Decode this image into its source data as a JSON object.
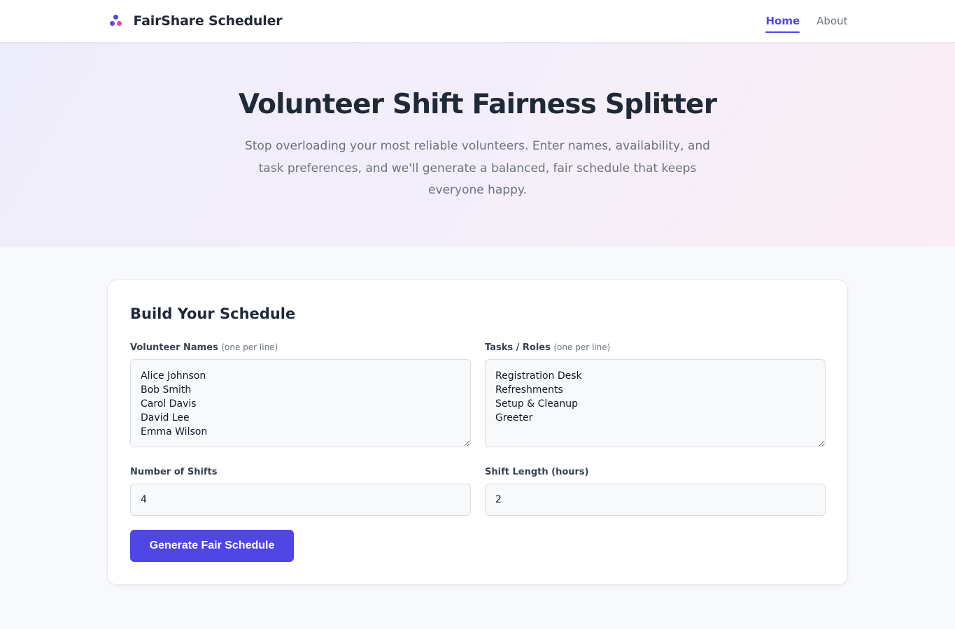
{
  "nav": {
    "brand": "FairShare Scheduler",
    "links": [
      {
        "label": "Home",
        "active": true
      },
      {
        "label": "About",
        "active": false
      }
    ]
  },
  "hero": {
    "title": "Volunteer Shift Fairness Splitter",
    "subtitle": "Stop overloading your most reliable volunteers. Enter names, availability, and task preferences, and we'll generate a balanced, fair schedule that keeps everyone happy."
  },
  "form": {
    "title": "Build Your Schedule",
    "volunteers": {
      "label": "Volunteer Names",
      "hint": "(one per line)",
      "value": "Alice Johnson\nBob Smith\nCarol Davis\nDavid Lee\nEmma Wilson"
    },
    "tasks": {
      "label": "Tasks / Roles",
      "hint": "(one per line)",
      "value": "Registration Desk\nRefreshments\nSetup & Cleanup\nGreeter"
    },
    "shifts": {
      "label": "Number of Shifts",
      "value": "4"
    },
    "shift_length": {
      "label": "Shift Length (hours)",
      "value": "2"
    },
    "submit_label": "Generate Fair Schedule"
  },
  "colors": {
    "accent": "#4f46e5",
    "logo_dots": [
      "#4f46e5",
      "#7c3aed",
      "#ec4899"
    ]
  }
}
